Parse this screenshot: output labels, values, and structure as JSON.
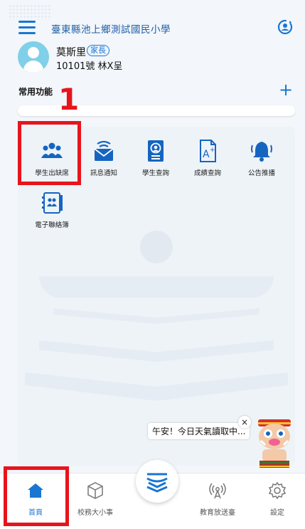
{
  "header": {
    "school_name": "臺東縣池上鄉測試國民小學"
  },
  "user": {
    "name": "莫斯里",
    "role_badge": "家長",
    "info": "10101號 林X呈"
  },
  "common_functions": {
    "title": "常用功能",
    "annotation": "1",
    "items": [
      {
        "label": "學生出缺席",
        "icon": "students-group-icon"
      },
      {
        "label": "訊息通知",
        "icon": "mail-notification-icon"
      },
      {
        "label": "學生查詢",
        "icon": "student-contact-book-icon"
      },
      {
        "label": "成績查詢",
        "icon": "grade-document-icon"
      },
      {
        "label": "公告推播",
        "icon": "bell-icon"
      },
      {
        "label": "電子聯絡簿",
        "icon": "e-contact-book-icon"
      }
    ]
  },
  "greeting": {
    "text": "午安！今日天氣讀取中...",
    "close": "×"
  },
  "bottom_nav": {
    "items": [
      {
        "label": "首頁",
        "icon": "home-icon",
        "active": true
      },
      {
        "label": "校務大小事",
        "icon": "cube-icon"
      },
      {
        "label": "",
        "icon": "school-logo-icon"
      },
      {
        "label": "教育放送臺",
        "icon": "broadcast-icon"
      },
      {
        "label": "設定",
        "icon": "settings-gear-icon"
      }
    ]
  },
  "colors": {
    "accent": "#1976d2",
    "highlight": "#e8141c",
    "background": "#f3f6fa"
  }
}
